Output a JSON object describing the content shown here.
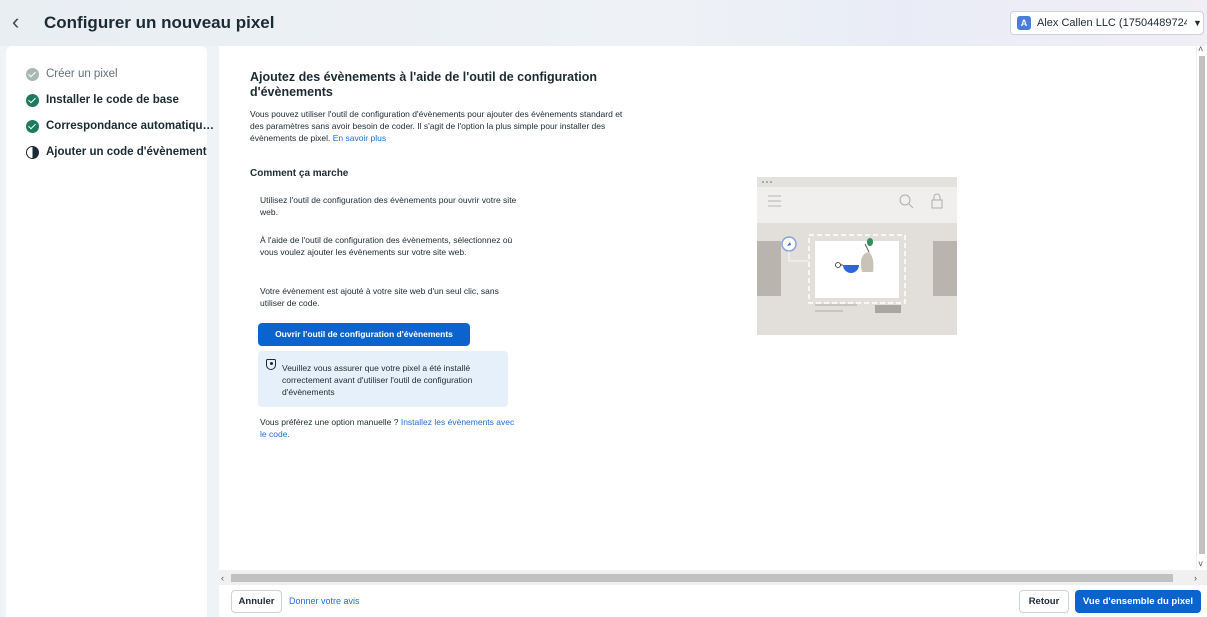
{
  "header": {
    "back_icon": "chevron-left-icon",
    "title": "Configurer un nouveau pixel",
    "account": {
      "badge": "A",
      "name": "Alex Callen LLC (1750448972421…"
    }
  },
  "sidebar": {
    "steps": [
      {
        "label": "Créer un pixel",
        "status": "done-muted"
      },
      {
        "label": "Installer le code de base",
        "status": "done"
      },
      {
        "label": "Correspondance automatiqu…",
        "status": "done"
      },
      {
        "label": "Ajouter un code d'évènement",
        "status": "in-progress"
      }
    ]
  },
  "main": {
    "title": "Ajoutez des évènements à l'aide de l'outil de configuration d'évènements",
    "description": "Vous pouvez utiliser l'outil de configuration d'évènements pour ajouter des évènements standard et des paramètres sans avoir besoin de coder. Il s'agit de l'option la plus simple pour installer des évènements de pixel.",
    "learn_more": "En savoir plus",
    "how_title": "Comment ça marche",
    "how_steps": [
      "Utilisez l'outil de configuration des évènements pour ouvrir votre site web.",
      "À l'aide de l'outil de configuration des évènements, sélectionnez où vous voulez ajouter les évènements sur votre site web.",
      "Votre évènement est ajouté à votre site web d'un seul clic, sans utiliser de code."
    ],
    "open_button": "Ouvrir l'outil de configuration d'évènements",
    "notice": "Veuillez vous assurer que votre pixel a été installé correctement avant d'utiliser l'outil de configuration d'évènements",
    "manual_prefix": "Vous préférez une option manuelle ?",
    "manual_link": "Installez les évènements avec le code."
  },
  "footer": {
    "cancel": "Annuler",
    "feedback": "Donner votre avis",
    "back": "Retour",
    "overview": "Vue d'ensemble du pixel"
  },
  "colors": {
    "primary": "#0b63ce",
    "link": "#216fdb",
    "success": "#1d7a5f"
  }
}
